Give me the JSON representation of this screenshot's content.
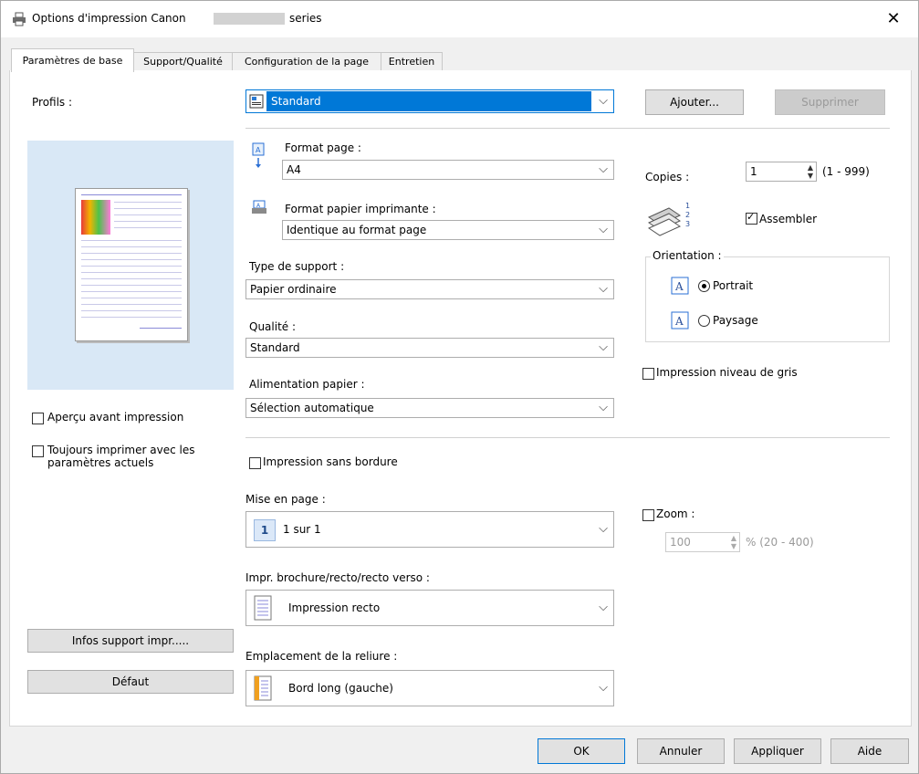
{
  "window": {
    "title_prefix": "Options d'impression Canon",
    "title_suffix": "series",
    "close": "✕"
  },
  "tabs": [
    {
      "label": "Paramètres de base"
    },
    {
      "label": "Support/Qualité"
    },
    {
      "label": "Configuration de la page"
    },
    {
      "label": "Entretien"
    }
  ],
  "profiles": {
    "label": "Profils :",
    "value": "Standard",
    "add": "Ajouter...",
    "delete": "Supprimer"
  },
  "page_size": {
    "label": "Format page :",
    "value": "A4"
  },
  "printer_paper_size": {
    "label": "Format papier imprimante :",
    "value": "Identique au format page"
  },
  "media_type": {
    "label": "Type de support :",
    "value": "Papier ordinaire"
  },
  "quality": {
    "label": "Qualité :",
    "value": "Standard"
  },
  "paper_source": {
    "label": "Alimentation papier :",
    "value": "Sélection automatique"
  },
  "copies": {
    "label": "Copies :",
    "value": "1",
    "range": "(1 - 999)"
  },
  "collate": {
    "label": "Assembler",
    "checked": true
  },
  "orientation": {
    "label": "Orientation :",
    "portrait": "Portrait",
    "landscape": "Paysage",
    "selected": "Portrait"
  },
  "grayscale": {
    "label": "Impression niveau de gris",
    "checked": false
  },
  "preview": {
    "label": "Aperçu avant impression",
    "checked": false
  },
  "always_print": {
    "label_line1": "Toujours imprimer avec les",
    "label_line2": "paramètres actuels",
    "checked": false
  },
  "borderless": {
    "label": "Impression sans bordure",
    "checked": false
  },
  "layout": {
    "label": "Mise en page :",
    "icon_num": "1",
    "value": "1 sur 1"
  },
  "zoom": {
    "label": "Zoom :",
    "value": "100",
    "range": "% (20 - 400)",
    "checked": false
  },
  "duplex": {
    "label": "Impr. brochure/recto/recto verso :",
    "value": "Impression recto"
  },
  "binding": {
    "label": "Emplacement de la reliure :",
    "value": "Bord long (gauche)"
  },
  "left_buttons": {
    "media_info": "Infos support impr.....",
    "defaults": "Défaut"
  },
  "footer": {
    "ok": "OK",
    "cancel": "Annuler",
    "apply": "Appliquer",
    "help": "Aide"
  },
  "colors": {
    "accent": "#0078d7",
    "panel_bg": "#ffffff",
    "window_bg": "#f0f0f0",
    "preview_bg": "#d9e8f6"
  }
}
